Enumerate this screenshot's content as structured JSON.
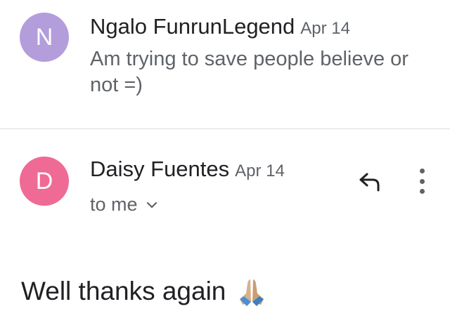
{
  "thread": {
    "messages": [
      {
        "avatar_letter": "N",
        "avatar_color": "#b39ddb",
        "sender": "Ngalo FunrunLegend",
        "date": "Apr 14",
        "snippet": "Am trying to save people believe or not =)"
      },
      {
        "avatar_letter": "D",
        "avatar_color": "#ef6a95",
        "sender": "Daisy Fuentes",
        "date": "Apr 14",
        "recipient": "to me",
        "body": "Well thanks again",
        "body_emoji": "folded-hands-emoji",
        "actions": {
          "reply_icon": "reply-icon",
          "more_icon": "more-vert-icon"
        }
      }
    ]
  }
}
